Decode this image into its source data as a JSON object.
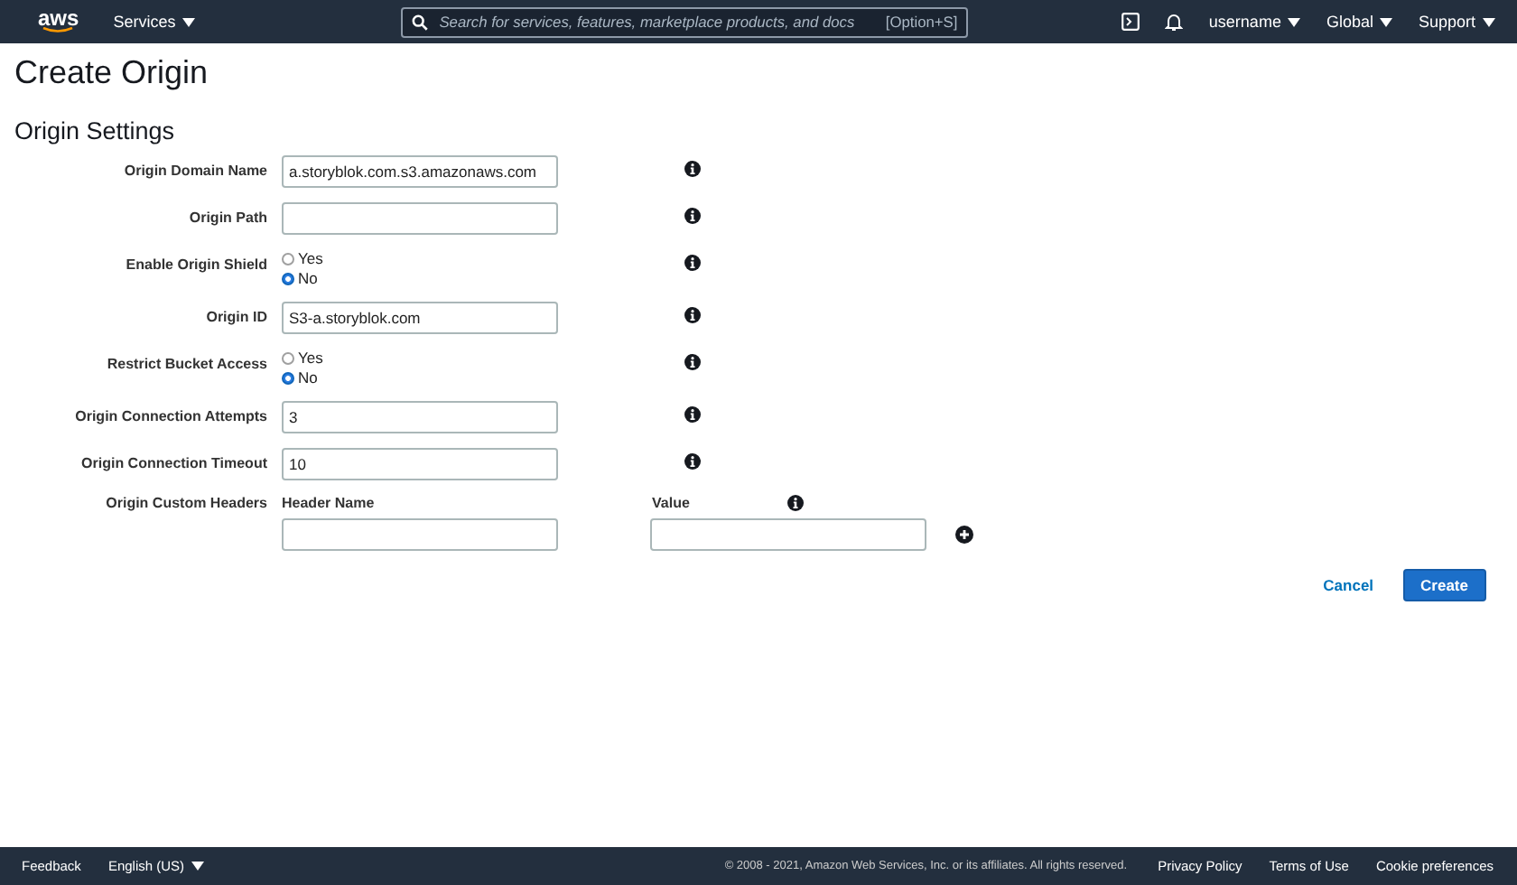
{
  "header": {
    "logo": "aws",
    "services": "Services",
    "search_placeholder": "Search for services, features, marketplace products, and docs",
    "shortcut": "[Option+S]",
    "user": "username",
    "region": "Global",
    "support": "Support"
  },
  "title": "Create Origin",
  "section": "Origin Settings",
  "rows": [
    {
      "kind": "text",
      "label": "Origin Domain Name",
      "value": "a.storyblok.com.s3.amazonaws.com"
    },
    {
      "kind": "text",
      "label": "Origin Path",
      "value": ""
    },
    {
      "kind": "radio",
      "label": "Enable Origin Shield",
      "options": [
        {
          "label": "Yes",
          "selected": false
        },
        {
          "label": "No",
          "selected": true
        }
      ]
    },
    {
      "kind": "text",
      "label": "Origin ID",
      "value": "S3-a.storyblok.com"
    },
    {
      "kind": "radio",
      "label": "Restrict Bucket Access",
      "options": [
        {
          "label": "Yes",
          "selected": false
        },
        {
          "label": "No",
          "selected": true
        }
      ]
    },
    {
      "kind": "text",
      "label": "Origin Connection Attempts",
      "value": "3"
    },
    {
      "kind": "text",
      "label": "Origin Connection Timeout",
      "value": "10"
    }
  ],
  "custom_headers": {
    "label": "Origin Custom Headers",
    "name_heading": "Header Name",
    "value_heading": "Value"
  },
  "buttons": {
    "cancel": "Cancel",
    "create": "Create"
  },
  "footer": {
    "feedback": "Feedback",
    "language": "English (US)",
    "copyright": "© 2008 - 2021, Amazon Web Services, Inc. or its affiliates. All rights reserved.",
    "links": [
      "Privacy Policy",
      "Terms of Use",
      "Cookie preferences"
    ]
  }
}
